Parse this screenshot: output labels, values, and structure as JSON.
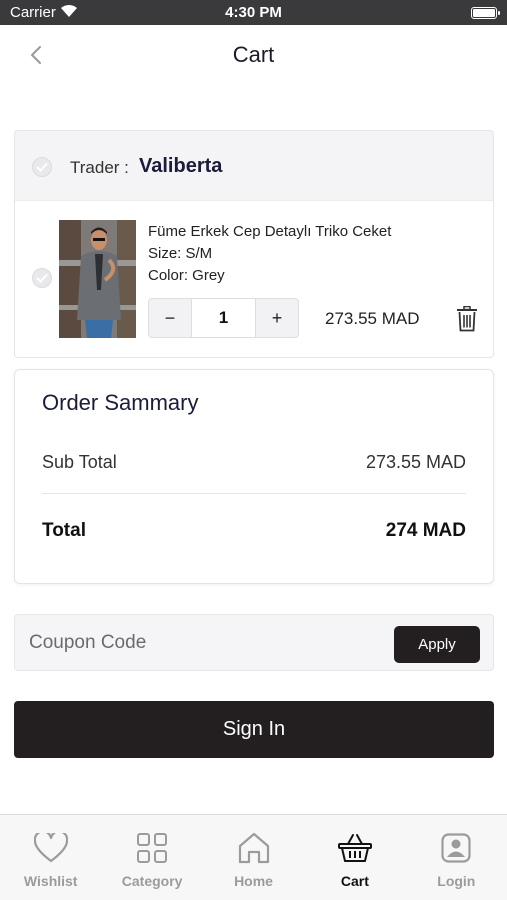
{
  "status_bar": {
    "carrier": "Carrier",
    "time": "4:30 PM"
  },
  "header": {
    "title": "Cart"
  },
  "trader": {
    "label": "Trader :",
    "name": "Valiberta"
  },
  "cart_item": {
    "name": "Füme Erkek Cep Detaylı Triko Ceket",
    "size": "Size: S/M",
    "color": "Color: Grey",
    "decrement": "−",
    "quantity": "1",
    "increment": "+",
    "price": "273.55 MAD"
  },
  "summary": {
    "title": "Order Sammary",
    "subtotal_label": "Sub Total",
    "subtotal_value": "273.55 MAD",
    "total_label": "Total",
    "total_value": "274 MAD"
  },
  "coupon": {
    "placeholder": "Coupon Code",
    "apply_label": "Apply"
  },
  "signin": {
    "label": "Sign In"
  },
  "tab_bar": {
    "active": "Cart",
    "tabs": [
      {
        "label": "Wishlist",
        "icon": "heart-icon"
      },
      {
        "label": "Category",
        "icon": "grid-icon"
      },
      {
        "label": "Home",
        "icon": "home-icon"
      },
      {
        "label": "Cart",
        "icon": "basket-icon"
      },
      {
        "label": "Login",
        "icon": "user-icon"
      }
    ]
  },
  "colors": {
    "primary_button": "#231f20",
    "inactive_tab": "#9b9b9b",
    "active_tab": "#111111"
  }
}
